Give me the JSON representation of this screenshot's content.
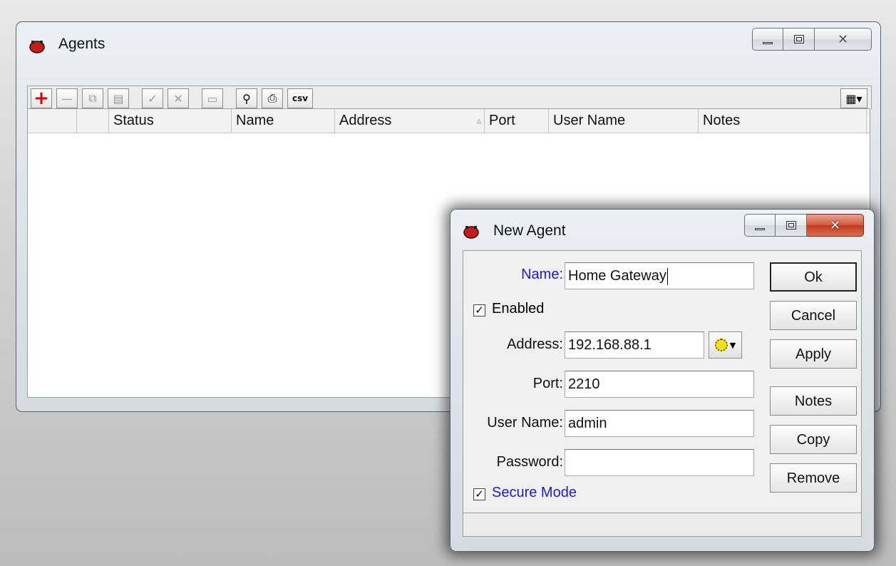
{
  "agents_window": {
    "title": "Agents",
    "toolbar": {
      "add": "add",
      "remove": "remove",
      "copy": "copy",
      "paste": "paste",
      "enable": "enable",
      "disable": "disable",
      "comment": "comment",
      "find": "find",
      "print": "print",
      "csv_label": "csv"
    },
    "columns": [
      "",
      "",
      "Status",
      "Name",
      "Address",
      "Port",
      "User Name",
      "Notes"
    ],
    "sorted_column": "Address"
  },
  "dialog": {
    "title": "New Agent",
    "labels": {
      "name": "Name:",
      "address": "Address:",
      "port": "Port:",
      "user_name": "User Name:",
      "password": "Password:"
    },
    "values": {
      "name": "Home Gateway",
      "address": "192.168.88.1",
      "port": "2210",
      "user_name": "admin",
      "password": ""
    },
    "checkboxes": {
      "enabled": {
        "label": "Enabled",
        "checked": true
      },
      "secure_mode": {
        "label": "Secure Mode",
        "checked": true
      }
    },
    "buttons": {
      "ok": "Ok",
      "cancel": "Cancel",
      "apply": "Apply",
      "notes": "Notes",
      "copy": "Copy",
      "remove": "Remove"
    }
  },
  "colors": {
    "label_highlight": "#1a1adb",
    "add_icon": "#d60000"
  }
}
